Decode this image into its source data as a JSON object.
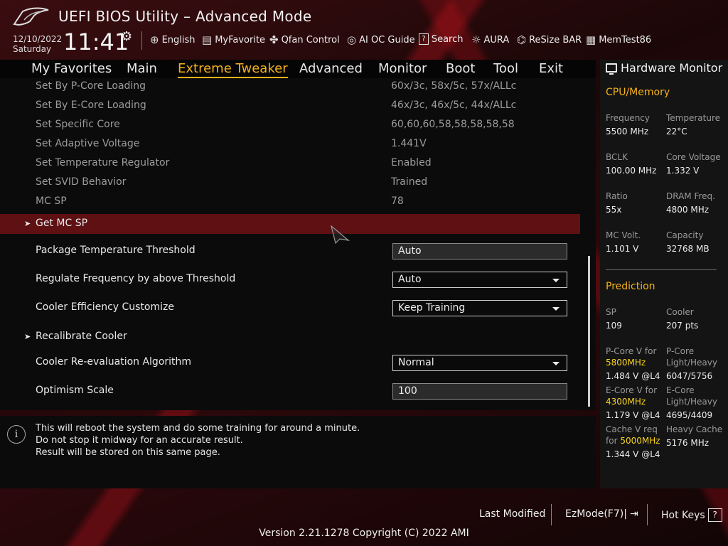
{
  "header": {
    "title": "UEFI BIOS Utility – Advanced Mode",
    "date": "12/10/2022",
    "day": "Saturday",
    "time": "11:41",
    "tools": [
      {
        "label": "English",
        "icon": "globe-icon"
      },
      {
        "label": "MyFavorite",
        "icon": "favorite-icon"
      },
      {
        "label": "Qfan Control",
        "icon": "fan-icon"
      },
      {
        "label": "AI OC Guide",
        "icon": "ai-guide-icon"
      },
      {
        "label": "Search",
        "icon": "search-icon"
      },
      {
        "label": "AURA",
        "icon": "aura-icon"
      },
      {
        "label": "ReSize BAR",
        "icon": "resize-bar-icon"
      },
      {
        "label": "MemTest86",
        "icon": "memtest-icon"
      }
    ]
  },
  "nav": {
    "tabs": [
      "My Favorites",
      "Main",
      "Extreme Tweaker",
      "Advanced",
      "Monitor",
      "Boot",
      "Tool",
      "Exit"
    ],
    "active": "Extreme Tweaker"
  },
  "settings": {
    "readonly": [
      {
        "label": "Set By P-Core Loading",
        "value": "60x/3c, 58x/5c, 57x/ALLc"
      },
      {
        "label": "Set By E-Core Loading",
        "value": "46x/3c, 46x/5c, 44x/ALLc"
      },
      {
        "label": "Set Specific Core",
        "value": "60,60,60,58,58,58,58,58"
      },
      {
        "label": "Set Adaptive Voltage",
        "value": "1.441V"
      },
      {
        "label": "Set Temperature Regulator",
        "value": "Enabled"
      },
      {
        "label": "Set SVID Behavior",
        "value": "Trained"
      },
      {
        "label": "MC SP",
        "value": "78"
      }
    ],
    "get_mc_sp": "Get MC SP",
    "package_temp": {
      "label": "Package Temperature Threshold",
      "value": "Auto"
    },
    "regulate_freq": {
      "label": "Regulate Frequency by above Threshold",
      "value": "Auto"
    },
    "cooler_eff": {
      "label": "Cooler Efficiency Customize",
      "value": "Keep Training"
    },
    "recalibrate": "Recalibrate Cooler",
    "cooler_reeval": {
      "label": "Cooler Re-evaluation Algorithm",
      "value": "Normal"
    },
    "optimism": {
      "label": "Optimism Scale",
      "value": "100"
    }
  },
  "help": {
    "lines": [
      "This will reboot the system and do some training for around a minute.",
      "Do not stop it midway for an accurate result.",
      "Result will be stored on this same page."
    ]
  },
  "hardware_monitor": {
    "title": "Hardware Monitor",
    "cpu_memory_title": "CPU/Memory",
    "cpu_memory": [
      {
        "label": "Frequency",
        "value": "5500 MHz"
      },
      {
        "label": "Temperature",
        "value": "22°C"
      },
      {
        "label": "BCLK",
        "value": "100.00 MHz"
      },
      {
        "label": "Core Voltage",
        "value": "1.332 V"
      },
      {
        "label": "Ratio",
        "value": "55x"
      },
      {
        "label": "DRAM Freq.",
        "value": "4800 MHz"
      },
      {
        "label": "MC Volt.",
        "value": "1.101 V"
      },
      {
        "label": "Capacity",
        "value": "32768 MB"
      }
    ],
    "prediction_title": "Prediction",
    "sp": {
      "label": "SP",
      "value": "109"
    },
    "cooler": {
      "label": "Cooler",
      "value": "207 pts"
    },
    "pcore_v": {
      "label": "P-Core V for",
      "freq": "5800MHz",
      "value": "1.484 V @L4"
    },
    "pcore_lh": {
      "label1": "P-Core",
      "label2": "Light/Heavy",
      "value": "6047/5756"
    },
    "ecore_v": {
      "label": "E-Core V for",
      "freq": "4300MHz",
      "value": "1.179 V @L4"
    },
    "ecore_lh": {
      "label1": "E-Core",
      "label2": "Light/Heavy",
      "value": "4695/4409"
    },
    "cache_v": {
      "label1": "Cache V req",
      "label2": "for",
      "freq": "5000MHz",
      "value": "1.344 V @L4"
    },
    "heavy_cache": {
      "label": "Heavy Cache",
      "value": "5176 MHz"
    }
  },
  "footer": {
    "last_modified": "Last Modified",
    "ezmode": "EzMode(F7)|",
    "hotkeys": "Hot Keys",
    "hotkeys_key": "?",
    "version": "Version 2.21.1278 Copyright (C) 2022 AMI"
  }
}
